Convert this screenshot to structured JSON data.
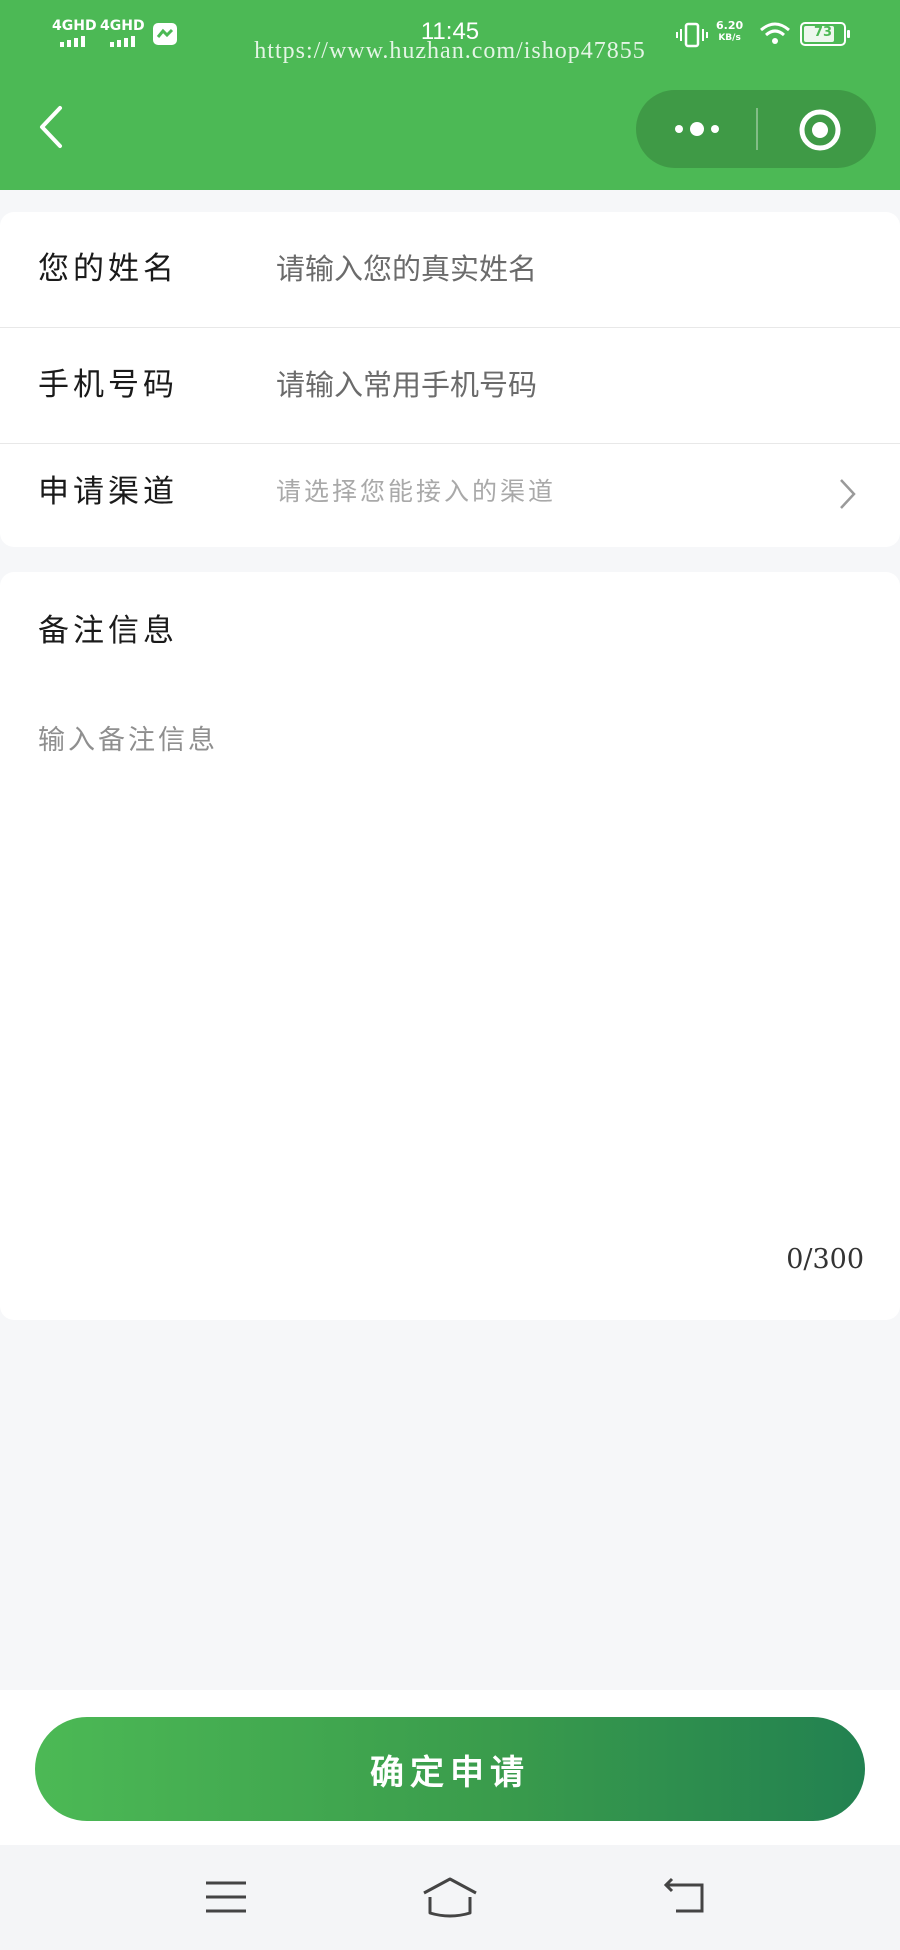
{
  "status_bar": {
    "network_1": "4GHD",
    "network_2": "4GHD",
    "time": "11:45",
    "net_speed_value": "6.20",
    "net_speed_unit": "KB/s",
    "battery": "73",
    "watermark": "https://www.huzhan.com/ishop47855"
  },
  "nav": {
    "back_icon": "chevron-left-icon",
    "more_icon": "more-dots-icon",
    "close_icon": "target-circle-icon"
  },
  "form": {
    "name": {
      "label": "您的姓名",
      "placeholder": "请输入您的真实姓名"
    },
    "phone": {
      "label": "手机号码",
      "placeholder": "请输入常用手机号码"
    },
    "channel": {
      "label": "申请渠道",
      "placeholder": "请选择您能接入的渠道"
    }
  },
  "notes": {
    "title": "备注信息",
    "placeholder": "输入备注信息",
    "counter": "0/300"
  },
  "submit_label": "确定申请",
  "colors": {
    "primary": "#4cb955",
    "primary_dark": "#228150",
    "capsule": "#3f9a46",
    "page_bg": "#f6f7f9"
  }
}
